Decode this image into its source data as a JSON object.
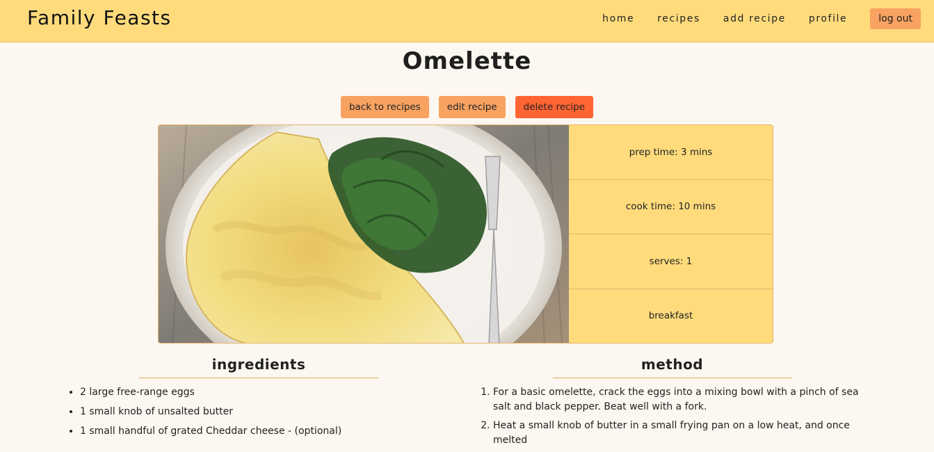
{
  "brand": "Family Feasts",
  "nav": {
    "items": [
      "home",
      "recipes",
      "add recipe",
      "profile"
    ],
    "logout": "log out"
  },
  "recipe": {
    "title": "Omelette",
    "actions": {
      "back": "back to recipes",
      "edit": "edit recipe",
      "delete": "delete recipe"
    },
    "info": {
      "prep": "prep time: 3 mins",
      "cook": "cook time: 10 mins",
      "serves": "serves: 1",
      "category": "breakfast"
    },
    "ingredients_heading": "ingredients",
    "method_heading": "method",
    "ingredients": [
      "2 large free-range eggs",
      "1 small knob of unsalted butter",
      "1 small handful of grated Cheddar cheese - (optional)"
    ],
    "method": [
      "For a basic omelette, crack the eggs into a mixing bowl with a pinch of sea salt and black pepper. Beat well with a fork.",
      "Heat a small knob of butter in a small frying pan on a low heat, and once melted"
    ]
  },
  "colors": {
    "header_bg": "#ffdb7c",
    "page_bg": "#fcf7f0",
    "button_orange": "#f8a262",
    "button_red": "#ff6433"
  },
  "icons": {
    "photo": "omelette-photo"
  }
}
